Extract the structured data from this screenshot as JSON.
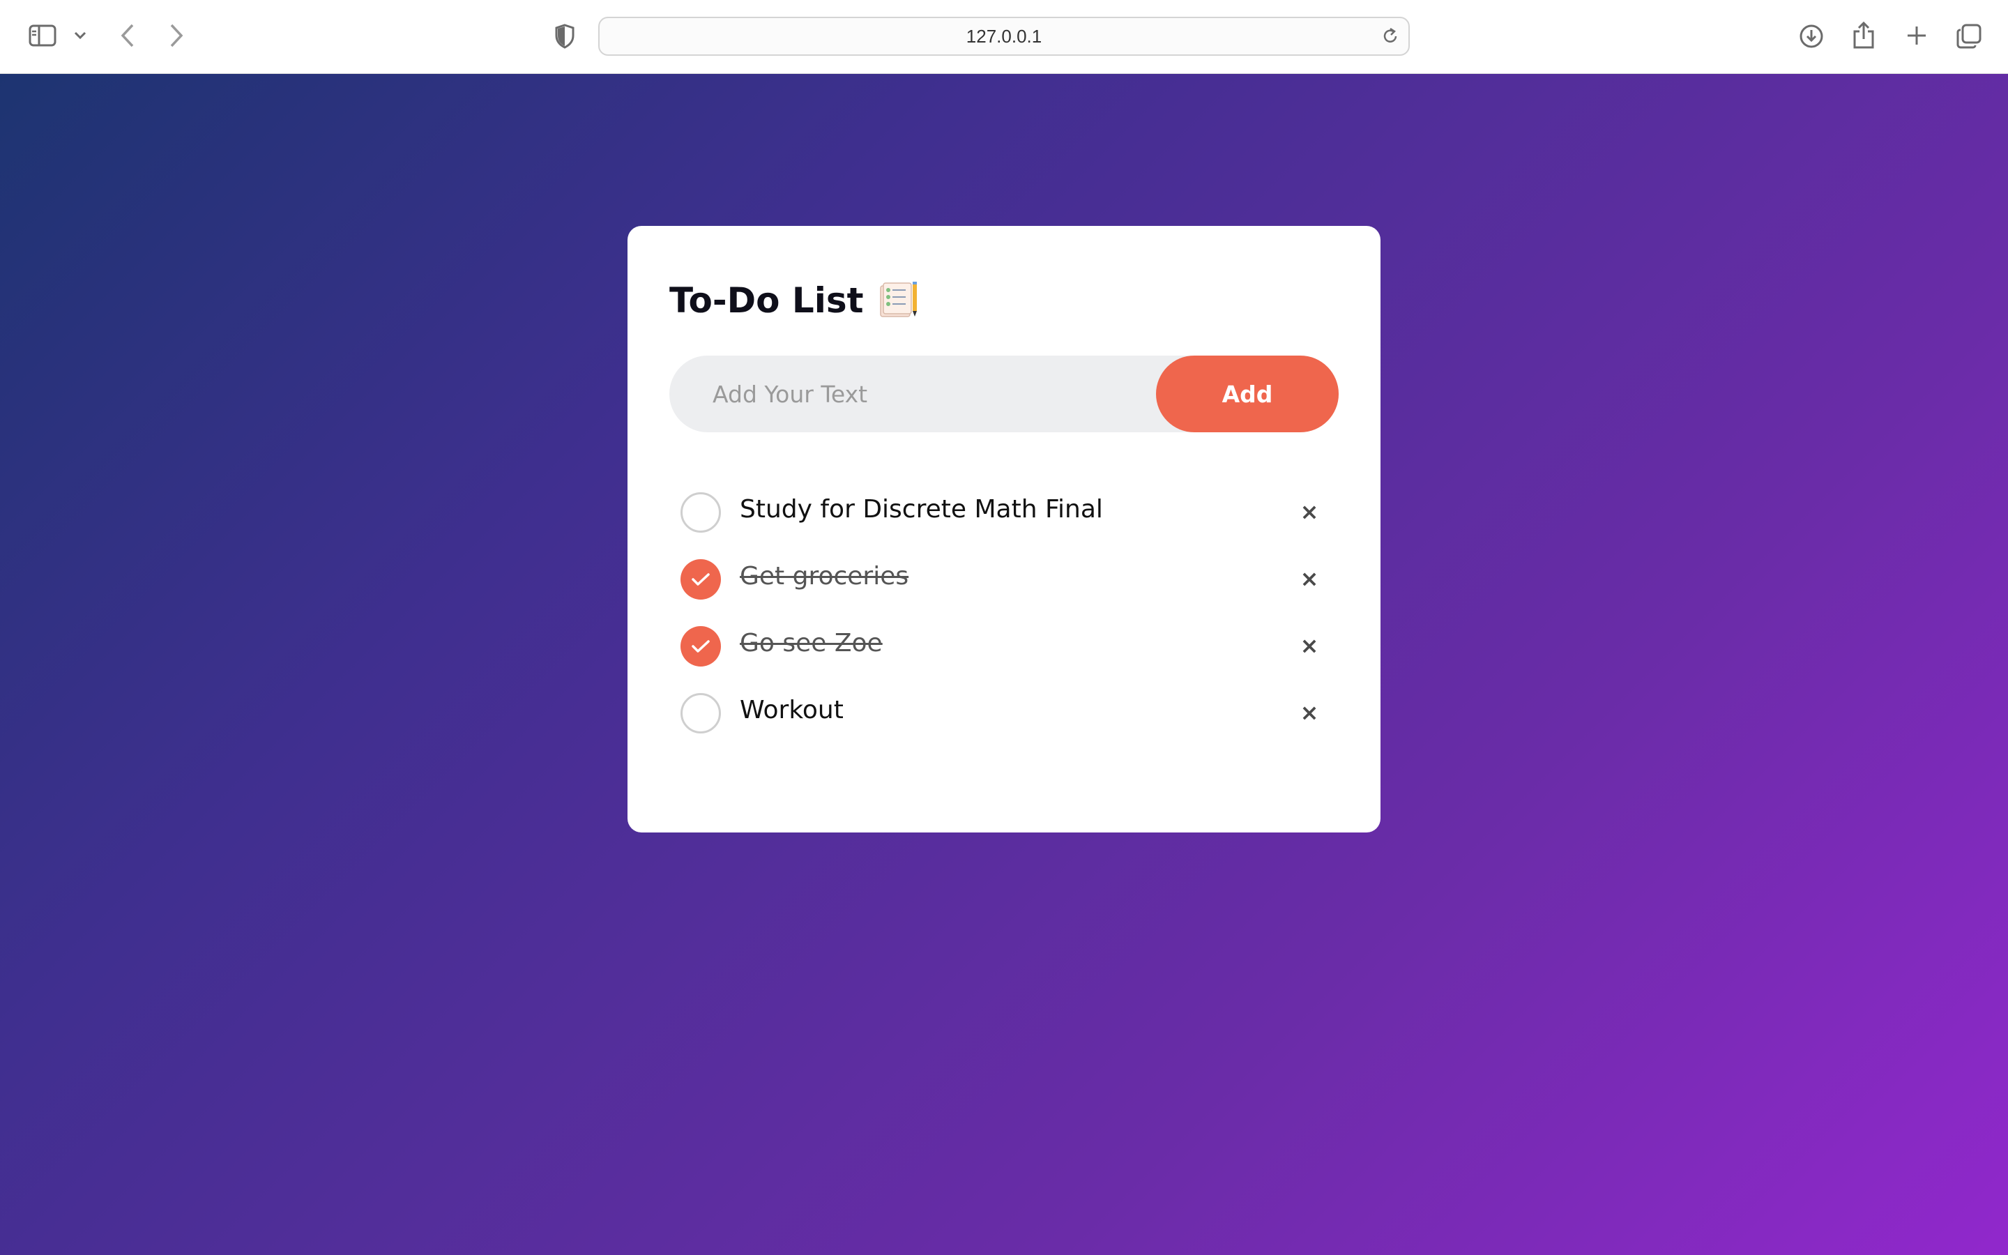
{
  "browser": {
    "address": "127.0.0.1",
    "icons": [
      "sidebar-icon",
      "chevron-down-icon",
      "back-icon",
      "forward-icon",
      "shield-icon",
      "reload-icon",
      "download-icon",
      "share-icon",
      "new-tab-icon",
      "tabs-overview-icon"
    ]
  },
  "app": {
    "title": "To-Do List",
    "title_icon": "notepad-checklist-icon",
    "input_placeholder": "Add Your Text",
    "add_label": "Add",
    "accent_color": "#ef664d",
    "tasks": [
      {
        "text": "Study for Discrete Math Final",
        "done": false
      },
      {
        "text": "Get groceries",
        "done": true
      },
      {
        "text": "Go see Zoe",
        "done": true
      },
      {
        "text": "Workout",
        "done": false
      }
    ],
    "delete_glyph": "×"
  }
}
